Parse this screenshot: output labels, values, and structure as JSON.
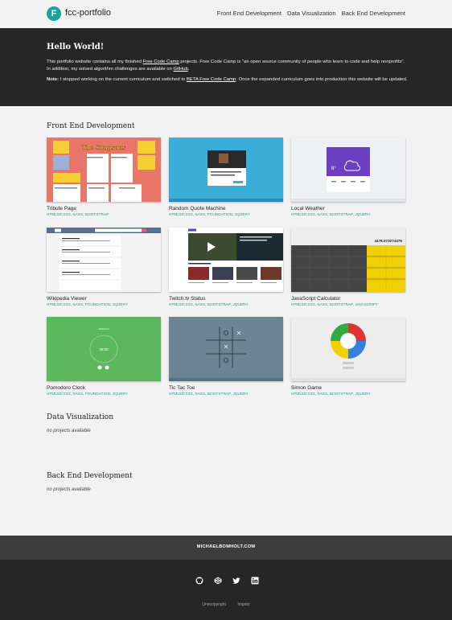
{
  "header": {
    "logo_letter": "F",
    "brand": "fcc-portfolio",
    "nav": [
      "Front End Development",
      "Data Visualization",
      "Back End Development"
    ]
  },
  "hero": {
    "title": "Hello World!",
    "p1_a": "This portfolio website contains all my finished ",
    "p1_link1": "Free Code Camp",
    "p1_b": " projects. Free Code Camp is \"an open source community of people who learn to code and help nonprofits\". In addition, my solved algorithm challenges are available on ",
    "p1_link2": "GitHub",
    "p1_c": ".",
    "note_label": "Note:",
    "p2_a": " I stopped working on the current curriculum and switched to ",
    "p2_link": "BETA Free Code Camp",
    "p2_b": ". Once the expanded curriculum goes into production this website will be updated."
  },
  "sections": {
    "frontend": {
      "title": "Front End Development",
      "projects": [
        {
          "title": "Tribute Page",
          "tech": "HTML5/CSS3, SASS, BOOTSTRAP"
        },
        {
          "title": "Random Quote Machine",
          "tech": "HTML5/CSS3, SASS, FOUNDATION, JQUERY"
        },
        {
          "title": "Local Weather",
          "tech": "HTML5/CSS3, SASS, BOOTSTRAP, JQUERY"
        },
        {
          "title": "Wikipedia Viewer",
          "tech": "HTML5/CSS3, SASS, FOUNDATION, JQUERY"
        },
        {
          "title": "Twitch.tv Status",
          "tech": "HTML5/CSS3, SASS, BOOTSTRAP, JQUERY"
        },
        {
          "title": "JavaScript Calculator",
          "tech": "HTML5/CSS3, SASS, BOOTSTRAP, JAVASCRIPT"
        },
        {
          "title": "Pomodoro Clock",
          "tech": "HTML5/CSS3, SASS, FOUNDATION, JQUERY"
        },
        {
          "title": "Tic Tac Toe",
          "tech": "HTML5/CSS3, SASS, BOOTSTRAP, JQUERY"
        },
        {
          "title": "Simon Game",
          "tech": "HTML5/CSS3, SASS, BOOTSTRAP, JQUERY"
        }
      ]
    },
    "dataviz": {
      "title": "Data Visualization",
      "empty": "no projects available"
    },
    "backend": {
      "title": "Back End Development",
      "empty": "no projects available"
    }
  },
  "thumb_text": {
    "simpsons": "The Simpsons",
    "weather_temp": "8°",
    "calc_display": "4478.073274479",
    "pomodoro_label": "SESSION",
    "pomodoro_time": "25:00"
  },
  "footer": {
    "site": "MICHAELBOMHOLT.COM",
    "social_icons": [
      "github-icon",
      "codepen-icon",
      "twitter-icon",
      "linkedin-icon"
    ],
    "links": [
      "Unocopyright",
      "Imprint"
    ]
  },
  "colors": {
    "accent": "#1aa39a",
    "hero_bg": "#262626",
    "footer_top_bg": "#3d3d3d"
  }
}
